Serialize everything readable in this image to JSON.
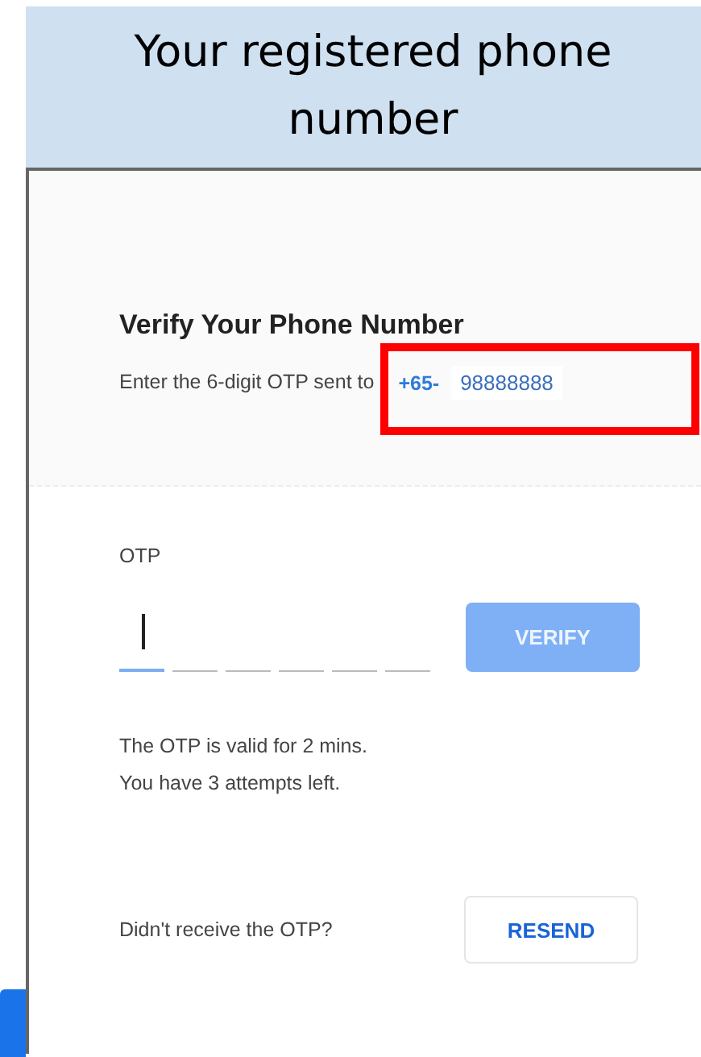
{
  "banner": {
    "title": "Your registered phone number"
  },
  "header": {
    "title": "Verify Your Phone Number",
    "subtitle_prefix": "Enter the 6-digit OTP sent to",
    "country_code": "+65-",
    "phone": "98888888",
    "highlighted": true
  },
  "otp": {
    "label": "OTP",
    "digits": [
      {
        "focused": true
      },
      {
        "focused": false
      },
      {
        "focused": false
      },
      {
        "focused": false
      },
      {
        "focused": false
      },
      {
        "focused": false
      }
    ],
    "verify_button": {
      "label": "VERIFY",
      "disabled": true
    }
  },
  "notes": [
    "The OTP is valid for 2 mins.",
    "You have 3 attempts left."
  ],
  "resend": {
    "prompt": "Didn't receive the OTP?",
    "button": "RESEND"
  }
}
